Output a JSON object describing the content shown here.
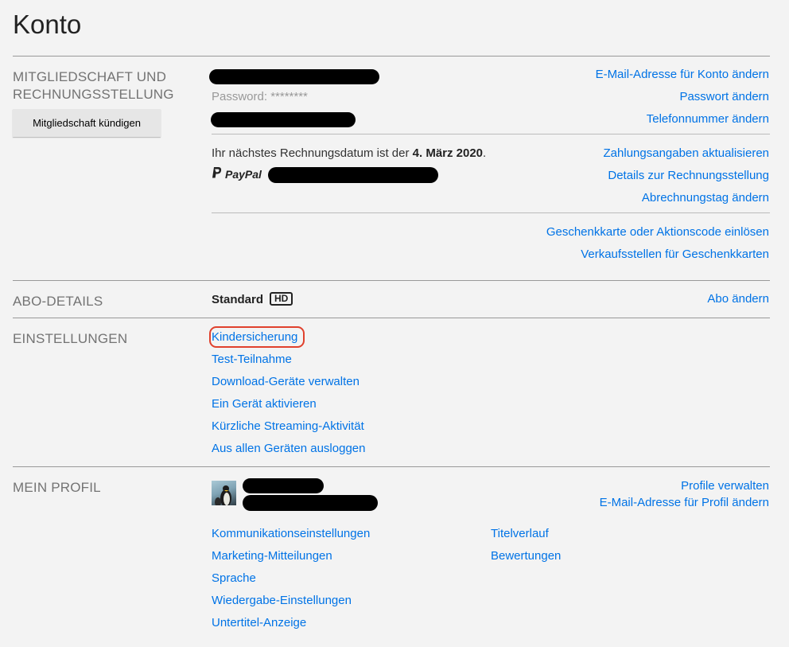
{
  "page": {
    "title": "Konto"
  },
  "membership": {
    "label_line1": "MITGLIEDSCHAFT UND",
    "label_line2": "RECHNUNGSSTELLUNG",
    "cancel_button": "Mitgliedschaft kündigen",
    "password_text": "Password: ********",
    "links": {
      "change_email": "E-Mail-Adresse für Konto ändern",
      "change_password": "Passwort ändern",
      "change_phone": "Telefonnummer ändern",
      "update_payment": "Zahlungsangaben aktualisieren",
      "billing_details": "Details zur Rechnungsstellung",
      "change_billing_day": "Abrechnungstag ändern",
      "redeem_gift": "Geschenkkarte oder Aktionscode einlösen",
      "gift_stores": "Verkaufsstellen für Geschenkkarten"
    },
    "billing_prefix": "Ihr nächstes Rechnungsdatum ist der ",
    "billing_date": "4. März 2020",
    "billing_suffix": ".",
    "payment_method": "PayPal"
  },
  "plan": {
    "label": "ABO-DETAILS",
    "name": "Standard",
    "badge": "HD",
    "change_link": "Abo ändern"
  },
  "settings": {
    "label": "EINSTELLUNGEN",
    "items": [
      "Kindersicherung",
      "Test-Teilnahme",
      "Download-Geräte verwalten",
      "Ein Gerät aktivieren",
      "Kürzliche Streaming-Aktivität",
      "Aus allen Geräten ausloggen"
    ]
  },
  "profile": {
    "label": "MEIN PROFIL",
    "manage_profiles": "Profile verwalten",
    "change_profile_email": "E-Mail-Adresse für Profil ändern",
    "left_links": [
      "Kommunikationseinstellungen",
      "Marketing-Mitteilungen",
      "Sprache",
      "Wiedergabe-Einstellungen",
      "Untertitel-Anzeige"
    ],
    "right_links": [
      "Titelverlauf",
      "Bewertungen"
    ]
  },
  "colors": {
    "link": "#0073e6",
    "background": "#f3f3f3",
    "highlight": "#e0412d"
  }
}
